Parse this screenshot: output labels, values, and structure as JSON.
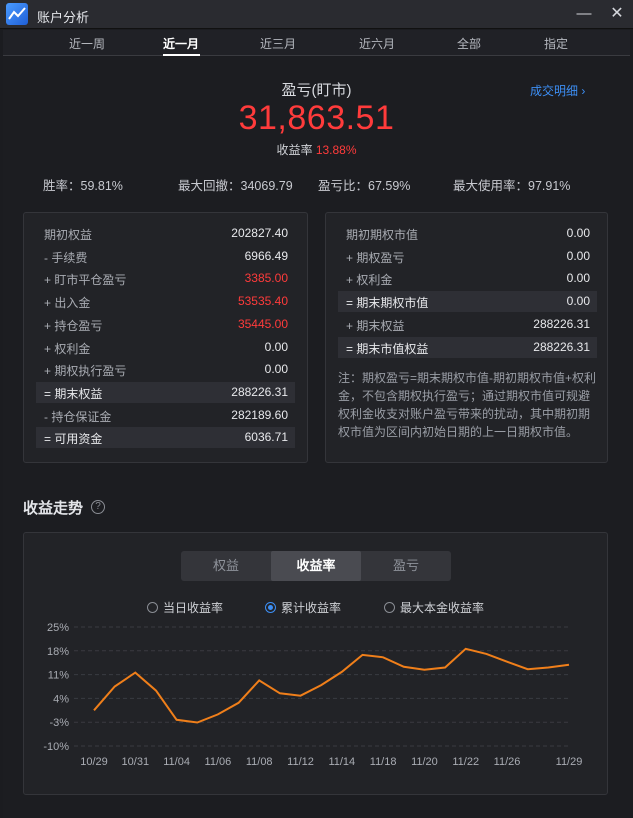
{
  "window": {
    "title": "账户分析",
    "minimize_icon": "minus-icon",
    "close_icon": "close-icon"
  },
  "tabs": [
    {
      "label": "近一周",
      "active": false
    },
    {
      "label": "近一月",
      "active": true
    },
    {
      "label": "近三月",
      "active": false
    },
    {
      "label": "近六月",
      "active": false
    },
    {
      "label": "全部",
      "active": false
    },
    {
      "label": "指定",
      "active": false
    }
  ],
  "summary": {
    "pnl_label": "盈亏(盯市)",
    "pnl_value": "31,863.51",
    "rate_label": "收益率",
    "rate_value": "13.88%",
    "detail_link": "成交明细",
    "detail_icon": "chevron-right-icon"
  },
  "stats": [
    {
      "label": "胜率：",
      "value": "59.81%"
    },
    {
      "label": "最大回撤：",
      "value": "34069.79"
    },
    {
      "label": "盈亏比：",
      "value": "67.59%"
    },
    {
      "label": "最大使用率：",
      "value": "97.91%"
    }
  ],
  "left_card": [
    {
      "label": "期初权益",
      "value": "202827.40",
      "highlight": false,
      "red": false
    },
    {
      "label": "- 手续费",
      "value": "6966.49",
      "highlight": false,
      "red": false
    },
    {
      "label": "+ 盯市平仓盈亏",
      "value": "3385.00",
      "highlight": false,
      "red": true
    },
    {
      "label": "+ 出入金",
      "value": "53535.40",
      "highlight": false,
      "red": true
    },
    {
      "label": "+ 持仓盈亏",
      "value": "35445.00",
      "highlight": false,
      "red": true
    },
    {
      "label": "+ 权利金",
      "value": "0.00",
      "highlight": false,
      "red": false
    },
    {
      "label": "+ 期权执行盈亏",
      "value": "0.00",
      "highlight": false,
      "red": false
    },
    {
      "label": "= 期末权益",
      "value": "288226.31",
      "highlight": true,
      "red": false
    },
    {
      "label": "- 持仓保证金",
      "value": "282189.60",
      "highlight": false,
      "red": false
    },
    {
      "label": "= 可用资金",
      "value": "6036.71",
      "highlight": true,
      "red": false
    }
  ],
  "right_card": [
    {
      "label": "期初期权市值",
      "value": "0.00",
      "highlight": false
    },
    {
      "label": "+ 期权盈亏",
      "value": "0.00",
      "highlight": false
    },
    {
      "label": "+ 权利金",
      "value": "0.00",
      "highlight": false
    },
    {
      "label": "= 期末期权市值",
      "value": "0.00",
      "highlight": true
    },
    {
      "label": "+ 期末权益",
      "value": "288226.31",
      "highlight": false
    },
    {
      "label": "= 期末市值权益",
      "value": "288226.31",
      "highlight": true
    }
  ],
  "note": "注：期权盈亏=期末期权市值-期初期权市值+权利金，不包含期权执行盈亏；通过期权市值可规避权利金收支对账户盈亏带来的扰动，其中期初期权市值为区间内初始日期的上一日期权市值。",
  "trend": {
    "title": "收益走势",
    "help_icon": "question-circle-icon",
    "segments": [
      {
        "label": "权益",
        "active": false
      },
      {
        "label": "收益率",
        "active": true
      },
      {
        "label": "盈亏",
        "active": false
      }
    ],
    "radios": [
      {
        "label": "当日收益率",
        "checked": false
      },
      {
        "label": "累计收益率",
        "checked": true
      },
      {
        "label": "最大本金收益率",
        "checked": false
      }
    ]
  },
  "chart_data": {
    "type": "line",
    "series": [
      {
        "line_color": "#f07f1a",
        "x": [
          "10/29",
          "10/30",
          "10/31",
          "11/01",
          "11/04",
          "11/05",
          "11/06",
          "11/07",
          "11/08",
          "11/11",
          "11/12",
          "11/13",
          "11/14",
          "11/15",
          "11/18",
          "11/19",
          "11/20",
          "11/21",
          "11/22",
          "11/25",
          "11/26",
          "11/27",
          "11/28",
          "11/29"
        ],
        "values": [
          0.5,
          7.5,
          11.6,
          6.3,
          -2.3,
          -3.1,
          -0.7,
          2.7,
          9.3,
          5.5,
          4.8,
          7.9,
          11.8,
          16.8,
          16.1,
          13.3,
          12.4,
          13.1,
          18.6,
          17.1,
          14.8,
          12.6,
          13.1,
          13.9
        ]
      }
    ],
    "x_tick_labels": [
      "10/29",
      "10/31",
      "11/04",
      "11/06",
      "11/08",
      "11/12",
      "11/14",
      "11/18",
      "11/20",
      "11/22",
      "11/26",
      "11/29"
    ],
    "y_tick_labels": [
      "25%",
      "18%",
      "11%",
      "4%",
      "-3%",
      "-10%"
    ],
    "ylim": [
      -10,
      25
    ],
    "grid": true,
    "grid_style": "dashed-horizontal",
    "legend": "none"
  }
}
